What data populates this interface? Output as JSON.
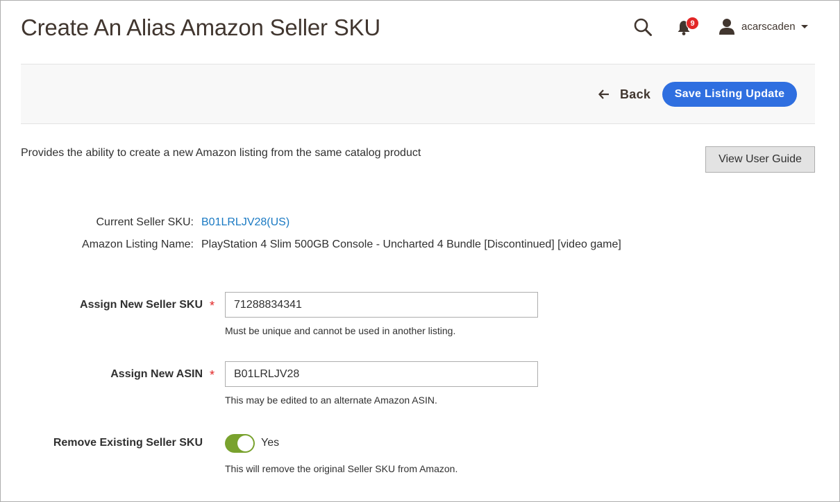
{
  "header": {
    "title": "Create An Alias Amazon Seller SKU",
    "notifications_count": "9",
    "username": "acarscaden"
  },
  "actions": {
    "back_label": "Back",
    "save_label": "Save Listing Update"
  },
  "intro": {
    "description": "Provides the ability to create a new Amazon listing from the same catalog product",
    "guide_button": "View User Guide"
  },
  "listing": {
    "current_sku_label": "Current Seller SKU:",
    "current_sku_value": "B01LRLJV28(US)",
    "name_label": "Amazon Listing Name:",
    "name_value": "PlayStation 4 Slim 500GB Console - Uncharted 4 Bundle [Discontinued] [video game]"
  },
  "form": {
    "seller_sku": {
      "label": "Assign New Seller SKU",
      "value": "71288834341",
      "note": "Must be unique and cannot be used in another listing."
    },
    "asin": {
      "label": "Assign New ASIN",
      "value": "B01LRLJV28",
      "note": "This may be edited to an alternate Amazon ASIN."
    },
    "remove_sku": {
      "label": "Remove Existing Seller SKU",
      "toggle_state": "Yes",
      "note": "This will remove the original Seller SKU from Amazon."
    },
    "required_mark": "*"
  },
  "colors": {
    "accent_blue": "#2f6fe0",
    "link_blue": "#1979c3",
    "toggle_green": "#79a22e",
    "required_red": "#e22626"
  }
}
